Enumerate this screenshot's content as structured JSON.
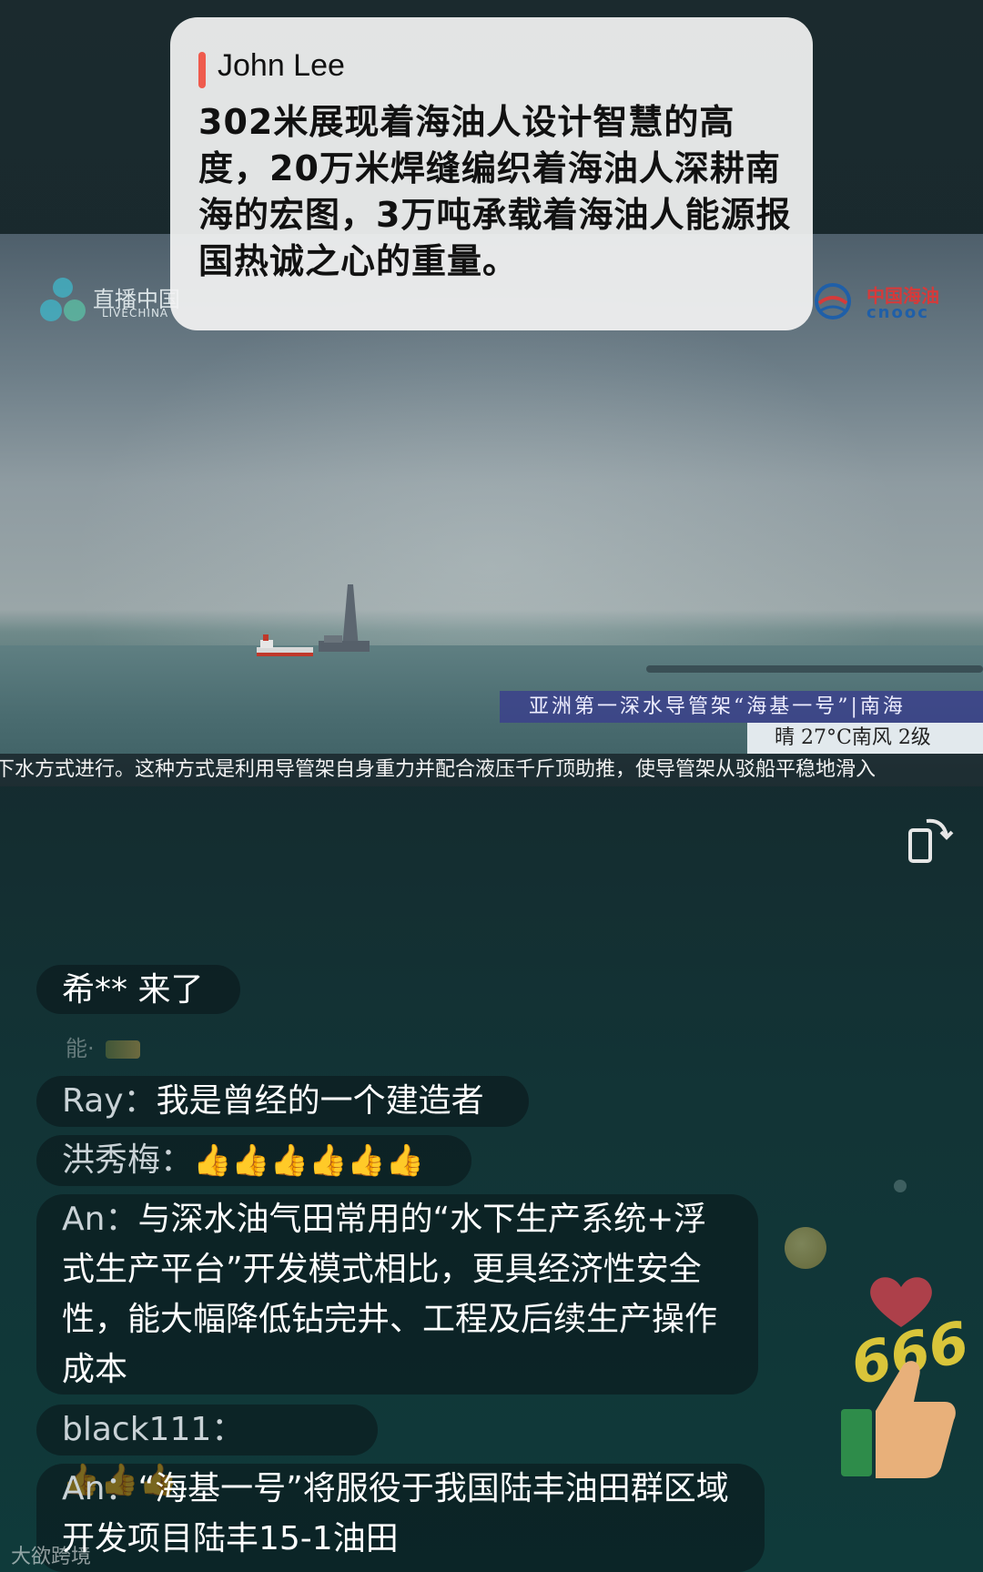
{
  "top_comment": {
    "author": "John Lee",
    "text": "302米展现着海油人设计智慧的高度，20万米焊缝编织着海油人深耕南海的宏图，3万吨承载着海油人能源报国热诚之心的重量。"
  },
  "video": {
    "logo_left_cn": "直播中国",
    "logo_left_en": "LIVECHINA",
    "logo_right_cn": "中国海油",
    "logo_right_en": "cnooc",
    "caption": "亚洲第一深水导管架“海基一号”|南海",
    "weather": "晴 27°C南风 2级",
    "subtitle": "下水方式进行。这种方式是利用导管架自身重力并配合液压千斤顶助推，使导管架从驳船平稳地滑入"
  },
  "chat": {
    "enter_notice": "希** 来了",
    "faded_name": "能·",
    "messages": [
      {
        "name": "Ray：",
        "text": "我是曾经的一个建造者"
      },
      {
        "name": "洪秀梅：",
        "text": "👍👍👍👍👍👍"
      },
      {
        "name": "An：",
        "text": "与深水油气田常用的“水下生产系统+浮式生产平台”开发模式相比，更具经济性安全性，能大幅降低钻完井、工程及后续生产操作成本"
      },
      {
        "name": "black111：",
        "text": "👍👍👍"
      },
      {
        "name": "An：",
        "text": "“海基一号”将服役于我国陆丰油田群区域开发项目陆丰15-1油田"
      }
    ]
  },
  "decor": {
    "reaction_text": "666",
    "watermark": "大欲跨境"
  },
  "icons": [
    "rotate-screen-icon",
    "heart-icon",
    "thumbs-up-icon"
  ],
  "colors": {
    "accent": "#ef5b4d",
    "caption_bg": "#3a408c",
    "cnooc_red": "#d63a3a",
    "cnooc_blue": "#1f5fa8"
  }
}
